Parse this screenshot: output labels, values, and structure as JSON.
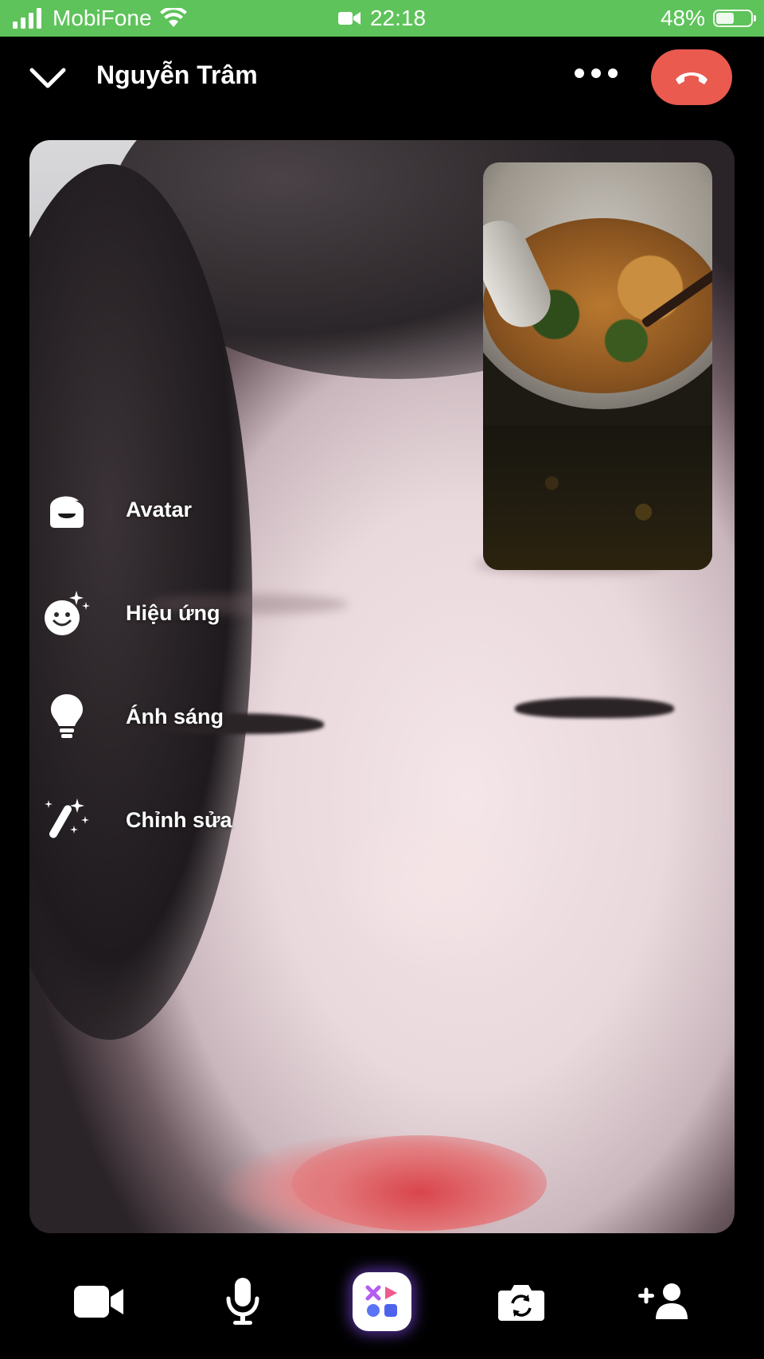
{
  "status_bar": {
    "carrier": "MobiFone",
    "time": "22:18",
    "battery_percent": "48%",
    "battery_level": 0.48,
    "icons": [
      "signal-icon",
      "wifi-icon",
      "video-call-indicator-icon",
      "battery-icon"
    ]
  },
  "header": {
    "caller_name": "Nguyễn Trâm",
    "icons": [
      "chevron-down-icon",
      "more-icon",
      "end-call-icon"
    ]
  },
  "side_menu": {
    "items": [
      {
        "label": "Avatar",
        "icon": "avatar-icon"
      },
      {
        "label": "Hiệu ứng",
        "icon": "effects-icon"
      },
      {
        "label": "Ánh sáng",
        "icon": "lightbulb-icon"
      },
      {
        "label": "Chỉnh sửa",
        "icon": "magic-wand-icon"
      }
    ]
  },
  "bottom_bar": {
    "buttons": [
      "video-camera-icon",
      "microphone-icon",
      "apps-icon",
      "flip-camera-icon",
      "add-person-icon"
    ]
  },
  "colors": {
    "status_bar_bg": "#5ec35a",
    "end_call": "#ea5a4f",
    "background": "#000000"
  }
}
